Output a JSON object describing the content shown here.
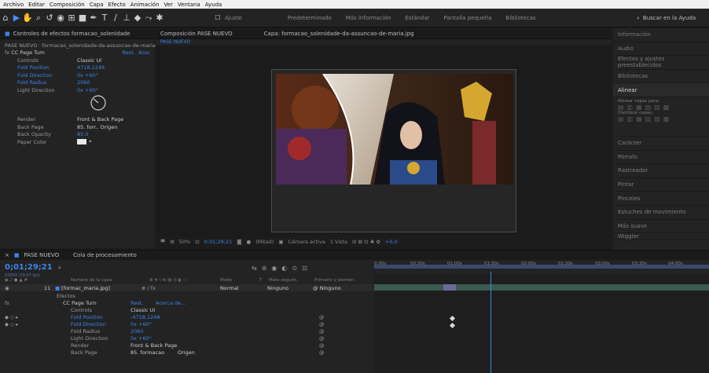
{
  "menubar": {
    "items": [
      "Archivo",
      "Editar",
      "Composición",
      "Capa",
      "Efecto",
      "Animación",
      "Ver",
      "Ventana",
      "Ayuda"
    ]
  },
  "toolbar": {
    "align_label": "Ajuste",
    "workspaces": [
      "Predeterminado",
      "Más información",
      "Estándar",
      "Pantalla pequeña",
      "Bibliotecas"
    ],
    "search_placeholder": "Buscar en la Ayuda"
  },
  "effects_panel": {
    "tab_title": "Controles de efectos formacao_solenidade",
    "layer_path": "PASE NUEVO · formacao_solenidade-da-assuncao-de-maria.jpg",
    "effect_name": "CC Page Turn",
    "reset": "Rest.",
    "about": "Acer.",
    "properties": [
      {
        "name": "Controls",
        "value": "Classic UI"
      },
      {
        "name": "Fold Position",
        "value": "4718,1248"
      },
      {
        "name": "Fold Direction",
        "value": "0x +60°"
      },
      {
        "name": "Fold Radius",
        "value": "2060"
      },
      {
        "name": "Light Direction",
        "value": "0x +60°"
      },
      {
        "name": "Render",
        "value": "Front & Back Page"
      },
      {
        "name": "Back Page",
        "value": "85. forr.."
      },
      {
        "name": "Back Opacity",
        "value": "85.0"
      },
      {
        "name": "Paper Color",
        "value": ""
      }
    ],
    "origin_label": "Origen"
  },
  "comp_panel": {
    "tab_title": "Composición PASE NUEVO",
    "layer_title": "Capa: formacao_solenidade-da-assuncao-de-maria.jpg",
    "crumb": "PASE NUEVO",
    "footer": {
      "zoom": "50%",
      "timecode": "0;01;29;21",
      "quality": "(Mitad)",
      "camera": "Cámara activa",
      "views": "1 Vista",
      "exposure": "+0,0"
    }
  },
  "right_panel": {
    "items": [
      "Información",
      "Audio",
      "Efectos y ajustes preestablecidos",
      "Bibliotecas",
      "Alinear",
      "Carácter",
      "Párrafo",
      "Rastreador",
      "Pintar",
      "Pinceles",
      "Estuches de movimiento",
      "Más suave",
      "Wiggler"
    ],
    "align_label": "Alinear capas para:",
    "distribute_label": "Distribuir capas:"
  },
  "timeline": {
    "tab": "PASE NUEVO",
    "render_queue": "Cola de procesamiento",
    "timecode": "0;01;29;21",
    "frames": "02693 (29,97 fps)",
    "headers": [
      "Nombre de la capa",
      "Modo",
      "T",
      "Mate seguim.",
      "Primario y elemen."
    ],
    "layer": {
      "index": "11",
      "name": "[formac_maria.jpg]",
      "mode": "Normal",
      "matte": "Ninguno",
      "parent": "Ninguno"
    },
    "effects_label": "Efectos",
    "effect": "CC Page Turn",
    "reset": "Rest.",
    "about": "Acerca de...",
    "rows": [
      {
        "name": "Controls",
        "value": "Classic UI"
      },
      {
        "name": "Fold Position",
        "value": "-4718,1248"
      },
      {
        "name": "Fold Direction",
        "value": "0x +60°"
      },
      {
        "name": "Fold Radius",
        "value": "2060"
      },
      {
        "name": "Light Direction",
        "value": "0x +60°"
      },
      {
        "name": "Render",
        "value": "Front & Back Page"
      },
      {
        "name": "Back Page",
        "value": "85. formacao"
      }
    ],
    "origin": "Origen",
    "ticks": [
      "0:00s",
      "00:30s",
      "01:00s",
      "01:30s",
      "02:00s",
      "02:30s",
      "03:00s",
      "03:30s",
      "04:00s"
    ]
  }
}
